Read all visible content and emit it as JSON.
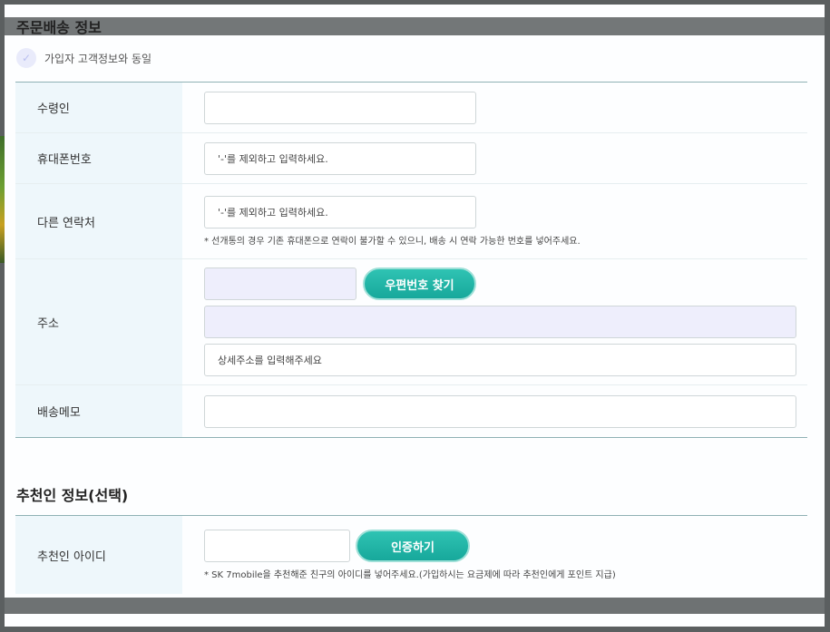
{
  "order_section": {
    "title": "주문배송 정보",
    "same_as_member_label": "가입자 고객정보와 동일",
    "check_icon": "✓"
  },
  "fields": {
    "recipient": {
      "label": "수령인",
      "value": ""
    },
    "mobile": {
      "label": "휴대폰번호",
      "placeholder": "'-'를 제외하고 입력하세요."
    },
    "other_contact": {
      "label": "다른 연락처",
      "placeholder": "'-'를 제외하고 입력하세요.",
      "hint": "* 선개통의 경우 기존 휴대폰으로 연락이 불가할 수 있으니, 배송 시 연락 가능한 번호를 넣어주세요."
    },
    "address": {
      "label": "주소",
      "zip_value": "",
      "find_zip_button": "우편번호 찾기",
      "road_address_value": "",
      "detail_placeholder": "상세주소를 입력해주세요"
    },
    "memo": {
      "label": "배송메모",
      "value": ""
    }
  },
  "referrer_section": {
    "title": "추천인 정보(선택)",
    "id_label": "추천인 아이디",
    "id_value": "",
    "verify_button": "인증하기",
    "hint": "* SK 7mobile을 추천해준 친구의 아이디를 넣어주세요.(가입하시는 요금제에 따라 추천인에게 포인트 지급)"
  },
  "colors": {
    "accent_teal": "#17a89b",
    "label_bg": "#eef7fb",
    "filled_input_bg": "#eeeefc"
  }
}
